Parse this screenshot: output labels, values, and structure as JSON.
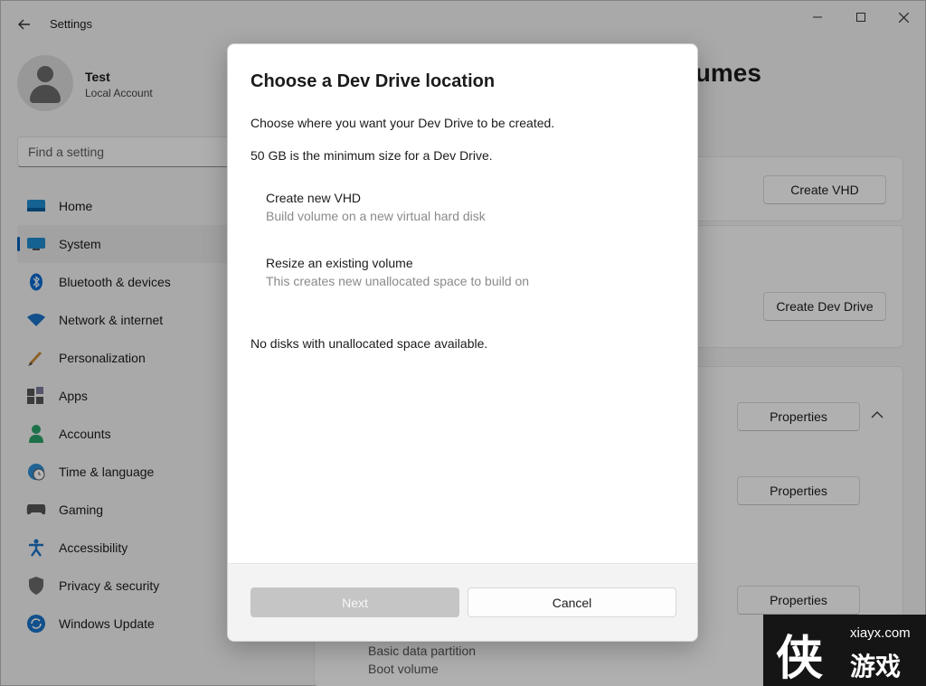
{
  "window": {
    "title": "Settings",
    "back_icon": "arrow-left-icon"
  },
  "profile": {
    "name": "Test",
    "account_type": "Local Account"
  },
  "search": {
    "placeholder": "Find a setting"
  },
  "nav": {
    "items": [
      {
        "label": "Home",
        "icon": "home-icon"
      },
      {
        "label": "System",
        "icon": "system-icon",
        "active": true
      },
      {
        "label": "Bluetooth & devices",
        "icon": "bluetooth-icon"
      },
      {
        "label": "Network & internet",
        "icon": "wifi-icon"
      },
      {
        "label": "Personalization",
        "icon": "brush-icon"
      },
      {
        "label": "Apps",
        "icon": "apps-icon"
      },
      {
        "label": "Accounts",
        "icon": "person-icon"
      },
      {
        "label": "Time & language",
        "icon": "clock-globe-icon"
      },
      {
        "label": "Gaming",
        "icon": "gamepad-icon"
      },
      {
        "label": "Accessibility",
        "icon": "accessibility-icon"
      },
      {
        "label": "Privacy & security",
        "icon": "shield-icon"
      },
      {
        "label": "Windows Update",
        "icon": "update-icon"
      }
    ]
  },
  "content": {
    "title_partial": "lumes",
    "create_vhd_label": "Create VHD",
    "create_dev_drive_label": "Create Dev Drive",
    "properties_label": "Properties",
    "partition_type": "Basic data partition",
    "partition_role": "Boot volume"
  },
  "dialog": {
    "title": "Choose a Dev Drive location",
    "description": "Choose where you want your Dev Drive to be created.",
    "min_size_note": "50 GB is the minimum size for a Dev Drive.",
    "options": [
      {
        "title": "Create new VHD",
        "desc": "Build volume on a new virtual hard disk"
      },
      {
        "title": "Resize an existing volume",
        "desc": "This creates new unallocated space to build on"
      }
    ],
    "status": "No disks with unallocated space available.",
    "next_label": "Next",
    "cancel_label": "Cancel"
  },
  "watermark": {
    "site": "xiayx.com",
    "logo_char": "侠",
    "cn_text": "游戏"
  },
  "colors": {
    "accent": "#005fb8",
    "dialog_bg": "#ffffff",
    "window_bg": "#f3f3f3"
  }
}
